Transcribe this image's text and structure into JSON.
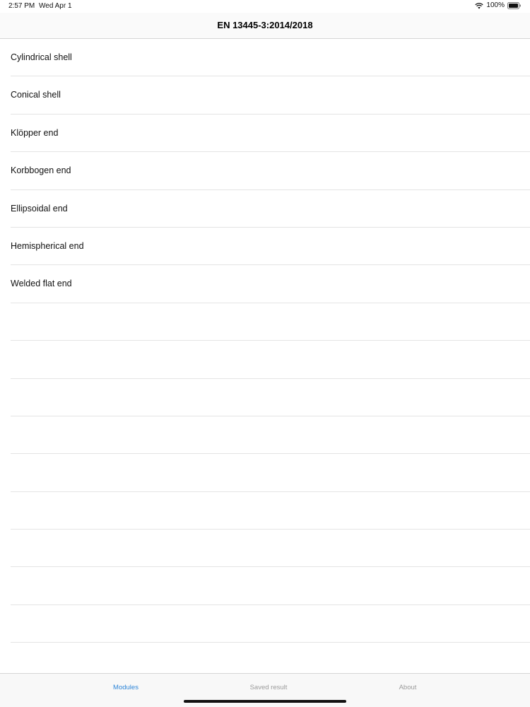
{
  "status_bar": {
    "time": "2:57 PM",
    "date": "Wed Apr 1",
    "battery": "100%",
    "wifi_icon": "wifi-icon",
    "battery_icon": "battery-icon"
  },
  "nav": {
    "title": "EN 13445-3:2014/2018"
  },
  "list": {
    "items": [
      {
        "label": "Cylindrical shell"
      },
      {
        "label": "Conical shell"
      },
      {
        "label": "Klöpper end"
      },
      {
        "label": "Korbbogen end"
      },
      {
        "label": "Ellipsoidal end"
      },
      {
        "label": "Hemispherical end"
      },
      {
        "label": "Welded flat end"
      },
      {
        "label": ""
      },
      {
        "label": ""
      },
      {
        "label": ""
      },
      {
        "label": ""
      },
      {
        "label": ""
      },
      {
        "label": ""
      },
      {
        "label": ""
      },
      {
        "label": ""
      },
      {
        "label": ""
      },
      {
        "label": ""
      }
    ]
  },
  "tabs": [
    {
      "label": "Modules",
      "active": true
    },
    {
      "label": "Saved result",
      "active": false
    },
    {
      "label": "About",
      "active": false
    }
  ],
  "colors": {
    "accent": "#2f86d8",
    "inactive_tab": "#9a9a9a",
    "separator": "#e4e4e4"
  }
}
